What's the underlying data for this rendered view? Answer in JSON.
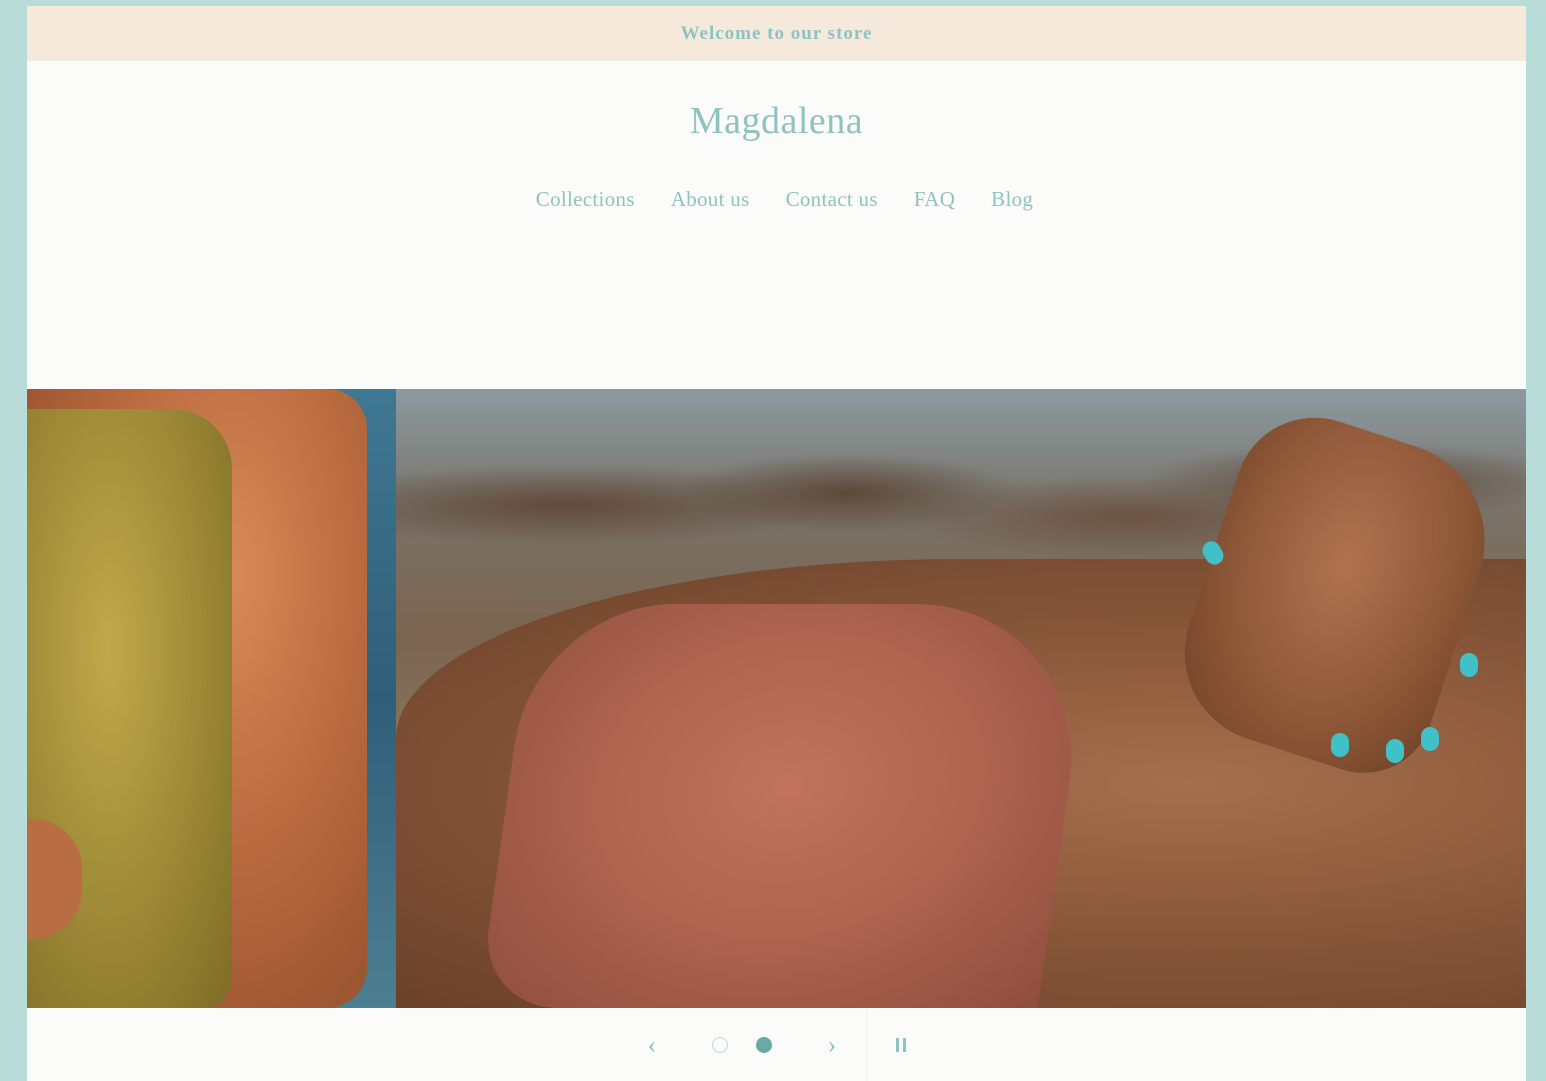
{
  "announcement": {
    "text": "Welcome to our store"
  },
  "header": {
    "logo_text": "Magdalena",
    "nav": [
      {
        "label": "Collections"
      },
      {
        "label": "About us"
      },
      {
        "label": "Contact us"
      },
      {
        "label": "FAQ"
      },
      {
        "label": "Blog"
      }
    ]
  },
  "slideshow": {
    "total_slides": 2,
    "active_slide": 2,
    "prev_icon": "chevron-left-icon",
    "next_icon": "chevron-right-icon",
    "pause_icon": "pause-icon"
  },
  "colors": {
    "accent": "#8fc3bf",
    "announcement_bg": "#f5e9db",
    "page_bg": "#b9dcd9",
    "active_dot": "#6aaaa6"
  }
}
